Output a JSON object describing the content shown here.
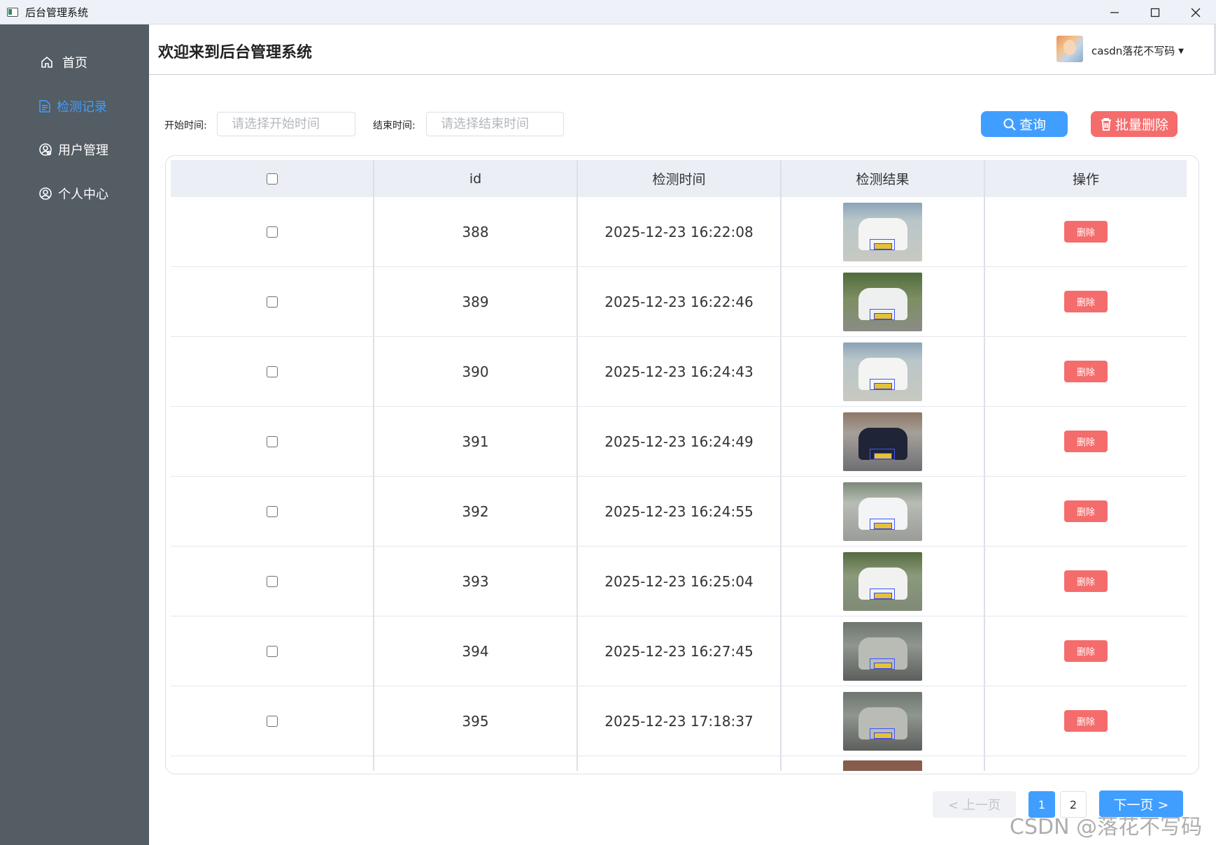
{
  "window": {
    "title": "后台管理系统"
  },
  "sidebar": {
    "items": [
      {
        "label": "首页",
        "icon": "home-icon",
        "active": false
      },
      {
        "label": "检测记录",
        "icon": "document-icon",
        "active": true
      },
      {
        "label": "用户管理",
        "icon": "user-manage-icon",
        "active": false
      },
      {
        "label": "个人中心",
        "icon": "user-circle-icon",
        "active": false
      }
    ],
    "active_color": "#409eff"
  },
  "header": {
    "welcome": "欢迎来到后台管理系统",
    "user_name": "casdn落花不写码"
  },
  "filters": {
    "start_label": "开始时间:",
    "start_placeholder": "请选择开始时间",
    "end_label": "结束时间:",
    "end_placeholder": "请选择结束时间",
    "query_label": "查询",
    "bulk_delete_label": "批量删除"
  },
  "table": {
    "columns": [
      "",
      "id",
      "检测时间",
      "检测结果",
      "操作"
    ],
    "delete_label": "删除",
    "rows": [
      {
        "id": "388",
        "time": "2025-12-23 16:22:08",
        "thumb": "white-sedan-rear"
      },
      {
        "id": "389",
        "time": "2025-12-23 16:22:46",
        "thumb": "white-suv-street"
      },
      {
        "id": "390",
        "time": "2025-12-23 16:24:43",
        "thumb": "white-sedan-rear"
      },
      {
        "id": "391",
        "time": "2025-12-23 16:24:49",
        "thumb": "dark-sedan-front"
      },
      {
        "id": "392",
        "time": "2025-12-23 16:24:55",
        "thumb": "white-van-rear"
      },
      {
        "id": "393",
        "time": "2025-12-23 16:25:04",
        "thumb": "white-suv-front"
      },
      {
        "id": "394",
        "time": "2025-12-23 16:27:45",
        "thumb": "gray-sedan-front"
      },
      {
        "id": "395",
        "time": "2025-12-23 17:18:37",
        "thumb": "gray-sedan-front"
      }
    ]
  },
  "pagination": {
    "prev_label": "< 上一页",
    "pages": [
      "1",
      "2"
    ],
    "current_page": "1",
    "next_label": "下一页 >"
  },
  "watermark": "CSDN @落花不写码",
  "colors": {
    "primary": "#409eff",
    "danger": "#f56c6c",
    "sidebar_bg": "#545c64",
    "table_header_bg": "#ebeef5"
  }
}
